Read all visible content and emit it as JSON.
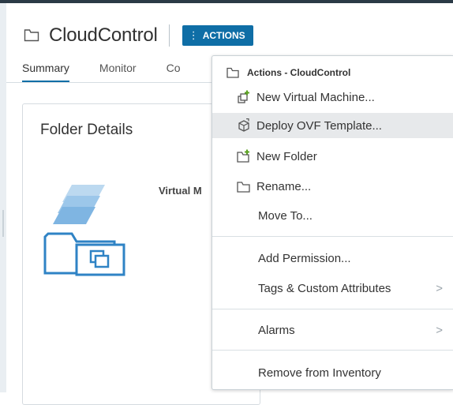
{
  "header": {
    "title": "CloudControl",
    "actions_kebab": "⋮",
    "actions_label": "ACTIONS"
  },
  "tabs": [
    {
      "label": "Summary"
    },
    {
      "label": "Monitor"
    },
    {
      "label": "Co"
    }
  ],
  "card": {
    "title": "Folder Details",
    "label": "Virtual M"
  },
  "menu": {
    "header": "Actions - CloudControl",
    "items": [
      {
        "label": "New Virtual Machine..."
      },
      {
        "label": "Deploy OVF Template..."
      },
      {
        "label": "New Folder"
      },
      {
        "label": "Rename..."
      },
      {
        "label": "Move To..."
      },
      {
        "label": "Add Permission..."
      },
      {
        "label": "Tags & Custom Attributes",
        "chevron": ">"
      },
      {
        "label": "Alarms",
        "chevron": ">"
      },
      {
        "label": "Remove from Inventory"
      }
    ]
  },
  "colors": {
    "accent": "#0f6ea6",
    "highlight": "#e7e9eb",
    "green_plus": "#5aa220",
    "folder_blue": "#2f83c5"
  }
}
